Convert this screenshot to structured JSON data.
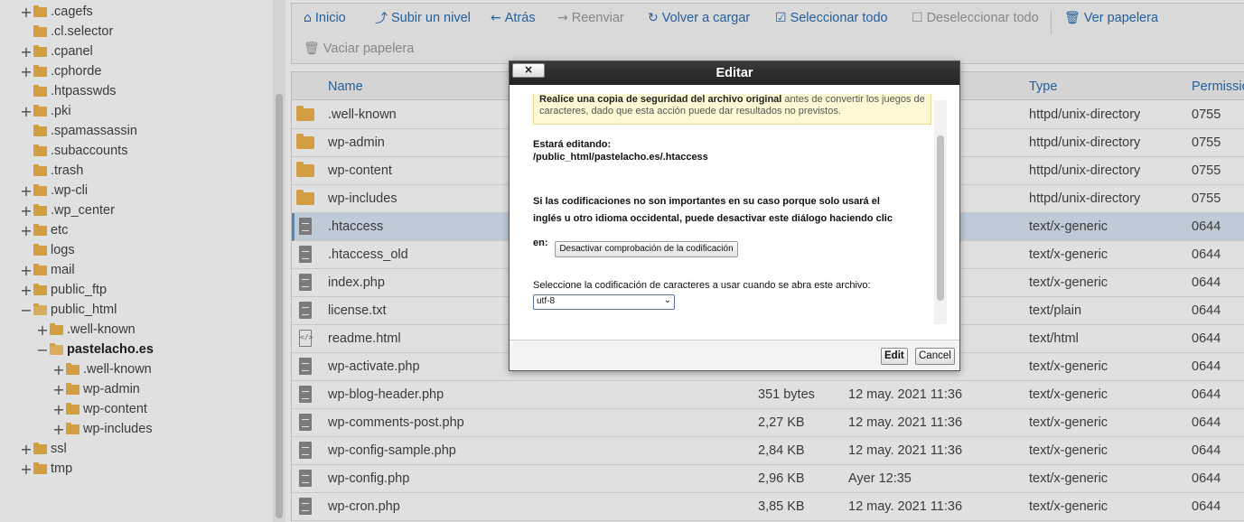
{
  "sidebar": {
    "items": [
      {
        "toggle": "+",
        "label": ".cagefs",
        "indent": 0
      },
      {
        "toggle": "",
        "label": ".cl.selector",
        "indent": 0
      },
      {
        "toggle": "+",
        "label": ".cpanel",
        "indent": 0
      },
      {
        "toggle": "+",
        "label": ".cphorde",
        "indent": 0
      },
      {
        "toggle": "",
        "label": ".htpasswds",
        "indent": 0
      },
      {
        "toggle": "+",
        "label": ".pki",
        "indent": 0
      },
      {
        "toggle": "",
        "label": ".spamassassin",
        "indent": 0
      },
      {
        "toggle": "",
        "label": ".subaccounts",
        "indent": 0
      },
      {
        "toggle": "",
        "label": ".trash",
        "indent": 0
      },
      {
        "toggle": "+",
        "label": ".wp-cli",
        "indent": 0
      },
      {
        "toggle": "+",
        "label": ".wp_center",
        "indent": 0
      },
      {
        "toggle": "+",
        "label": "etc",
        "indent": 0
      },
      {
        "toggle": "",
        "label": "logs",
        "indent": 0
      },
      {
        "toggle": "+",
        "label": "mail",
        "indent": 0
      },
      {
        "toggle": "+",
        "label": "public_ftp",
        "indent": 0
      },
      {
        "toggle": "−",
        "label": "public_html",
        "indent": 0,
        "open": true
      },
      {
        "toggle": "+",
        "label": ".well-known",
        "indent": 1
      },
      {
        "toggle": "−",
        "label": "pastelacho.es",
        "indent": 1,
        "open": true,
        "bold": true
      },
      {
        "toggle": "+",
        "label": ".well-known",
        "indent": 2
      },
      {
        "toggle": "+",
        "label": "wp-admin",
        "indent": 2
      },
      {
        "toggle": "+",
        "label": "wp-content",
        "indent": 2
      },
      {
        "toggle": "+",
        "label": "wp-includes",
        "indent": 2
      },
      {
        "toggle": "+",
        "label": "ssl",
        "indent": 0
      },
      {
        "toggle": "+",
        "label": "tmp",
        "indent": 0
      }
    ]
  },
  "toolbar": {
    "home": {
      "icon": "home-icon",
      "label": "Inicio"
    },
    "up": {
      "icon": "level-up-icon",
      "label": "Subir un nivel"
    },
    "back": {
      "icon": "arrow-left-icon",
      "label": "Atrás"
    },
    "forward": {
      "icon": "arrow-right-icon",
      "label": "Reenviar"
    },
    "reload": {
      "icon": "refresh-icon",
      "label": "Volver a cargar"
    },
    "select_all": {
      "icon": "checked-box-icon",
      "label": "Seleccionar todo"
    },
    "deselect_all": {
      "icon": "empty-box-icon",
      "label": "Deseleccionar todo"
    },
    "view_trash": {
      "icon": "trash-icon",
      "label": "Ver papelera"
    },
    "empty_trash": {
      "icon": "trash-icon",
      "label": "Vaciar papelera"
    }
  },
  "table": {
    "headers": {
      "name": "Name",
      "type": "Type",
      "permissions": "Permissio"
    },
    "rows": [
      {
        "icon": "folder",
        "name": ".well-known",
        "size": "",
        "date": "",
        "type": "httpd/unix-directory",
        "perm": "0755"
      },
      {
        "icon": "folder",
        "name": "wp-admin",
        "size": "",
        "date": "",
        "type": "httpd/unix-directory",
        "perm": "0755"
      },
      {
        "icon": "folder",
        "name": "wp-content",
        "size": "",
        "date": "",
        "type": "httpd/unix-directory",
        "perm": "0755"
      },
      {
        "icon": "folder",
        "name": "wp-includes",
        "size": "",
        "date": "",
        "type": "httpd/unix-directory",
        "perm": "0755"
      },
      {
        "icon": "doc",
        "name": ".htaccess",
        "size": "",
        "date": "",
        "type": "text/x-generic",
        "perm": "0644",
        "selected": true
      },
      {
        "icon": "doc",
        "name": ".htaccess_old",
        "size": "",
        "date": "",
        "type": "text/x-generic",
        "perm": "0644"
      },
      {
        "icon": "doc",
        "name": "index.php",
        "size": "",
        "date": "",
        "type": "text/x-generic",
        "perm": "0644"
      },
      {
        "icon": "doc",
        "name": "license.txt",
        "size": "",
        "date": "",
        "type": "text/plain",
        "perm": "0644"
      },
      {
        "icon": "html",
        "name": "readme.html",
        "size": "",
        "date": "",
        "type": "text/html",
        "perm": "0644"
      },
      {
        "icon": "doc",
        "name": "wp-activate.php",
        "size": "",
        "date": "",
        "type": "text/x-generic",
        "perm": "0644"
      },
      {
        "icon": "doc",
        "name": "wp-blog-header.php",
        "size": "351 bytes",
        "date": "12 may. 2021 11:36",
        "type": "text/x-generic",
        "perm": "0644"
      },
      {
        "icon": "doc",
        "name": "wp-comments-post.php",
        "size": "2,27 KB",
        "date": "12 may. 2021 11:36",
        "type": "text/x-generic",
        "perm": "0644"
      },
      {
        "icon": "doc",
        "name": "wp-config-sample.php",
        "size": "2,84 KB",
        "date": "12 may. 2021 11:36",
        "type": "text/x-generic",
        "perm": "0644"
      },
      {
        "icon": "doc",
        "name": "wp-config.php",
        "size": "2,96 KB",
        "date": "Ayer 12:35",
        "type": "text/x-generic",
        "perm": "0644"
      },
      {
        "icon": "doc",
        "name": "wp-cron.php",
        "size": "3,85 KB",
        "date": "12 may. 2021 11:36",
        "type": "text/x-generic",
        "perm": "0644"
      }
    ]
  },
  "dialog": {
    "title": "Editar",
    "close_label": "×",
    "warning_bold": "Realice una copia de seguridad del archivo original",
    "warning_rest": " antes de convertir los juegos de caracteres, dado que esta acción puede dar resultados no previstos.",
    "editing_label": "Estará editando:",
    "editing_path": "/public_html/pastelacho.es/.htaccess",
    "encoding_note_line1": "Si las codificaciones no son importantes en su caso porque solo usará el",
    "encoding_note_line2": "inglés u otro idioma occidental, puede desactivar este diálogo haciendo clic",
    "encoding_note_line3": "en:",
    "disable_check_label": "Desactivar comprobación de la codificación",
    "select_prompt": "Seleccione la codificación de caracteres a usar cuando se abra este archivo:",
    "encoding_value": "utf-8",
    "edit_label": "Edit",
    "cancel_label": "Cancel"
  },
  "colors": {
    "accent": "#2a6db4",
    "folder": "#f0b44d",
    "selected_row": "#d9e8f5"
  }
}
